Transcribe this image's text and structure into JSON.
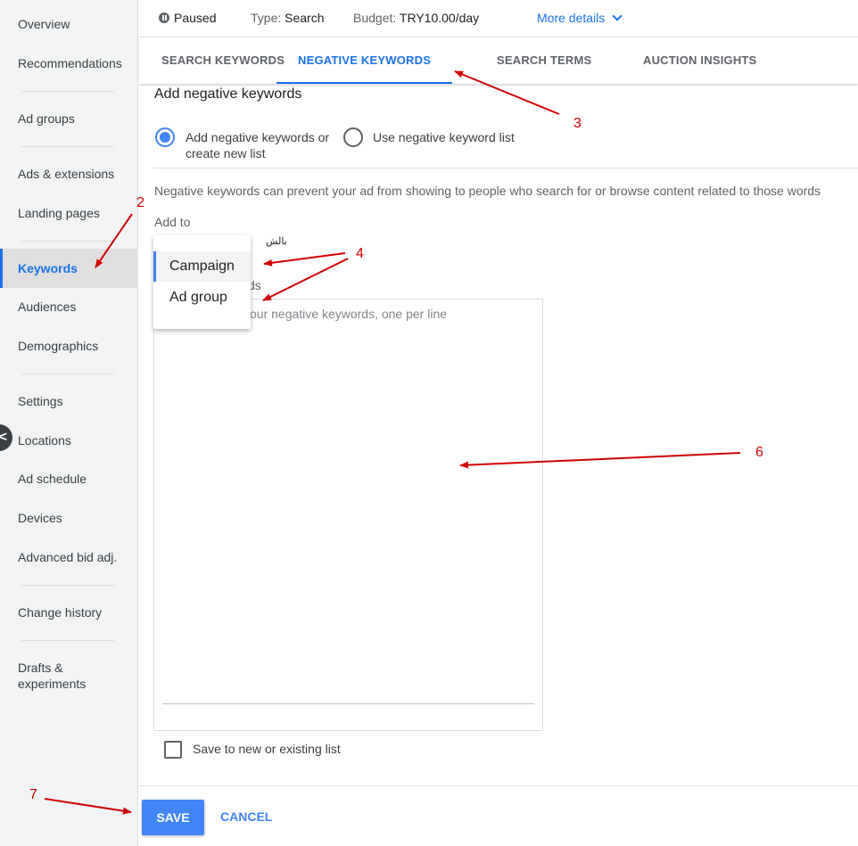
{
  "sidebar": {
    "items": [
      {
        "label": "Overview"
      },
      {
        "label": "Recommendations"
      },
      {
        "label": "Ad groups"
      },
      {
        "label": "Ads & extensions"
      },
      {
        "label": "Landing pages"
      },
      {
        "label": "Keywords"
      },
      {
        "label": "Audiences"
      },
      {
        "label": "Demographics"
      },
      {
        "label": "Settings"
      },
      {
        "label": "Locations"
      },
      {
        "label": "Ad schedule"
      },
      {
        "label": "Devices"
      },
      {
        "label": "Advanced bid adj."
      },
      {
        "label": "Change history"
      },
      {
        "label": "Drafts &"
      },
      {
        "label": "experiments"
      }
    ],
    "active": "Keywords",
    "collapse_glyph": "<"
  },
  "status_bar": {
    "status": "Paused",
    "type_label": "Type:",
    "type_value": "Search",
    "budget_label": "Budget:",
    "budget_value": "TRY10.00/day",
    "more_details": "More details"
  },
  "tabs": [
    {
      "label": "SEARCH KEYWORDS"
    },
    {
      "label": "NEGATIVE KEYWORDS"
    },
    {
      "label": "SEARCH TERMS"
    },
    {
      "label": "AUCTION INSIGHTS"
    }
  ],
  "form": {
    "title": "Add negative keywords",
    "option_add_line1": "Add negative keywords or",
    "option_add_line2": "create new list",
    "option_list": "Use negative keyword list",
    "description": "Negative keywords can prevent your ad from showing to people who search for or browse content related to those words",
    "add_to_label": "Add to",
    "arabic_text": "بالش",
    "keywords_label_fragment": "ds",
    "textarea_placeholder": "our negative keywords, one per line",
    "dropdown_options": [
      "Campaign",
      "Ad group"
    ],
    "save_list_label": "Save to new or existing list"
  },
  "actions": {
    "save": "SAVE",
    "cancel": "CANCEL"
  },
  "annotations": [
    "2",
    "3",
    "4",
    "6",
    "7"
  ],
  "colors": {
    "accent": "#1a73e8",
    "button": "#4285f4",
    "annotation": "#d00000"
  }
}
